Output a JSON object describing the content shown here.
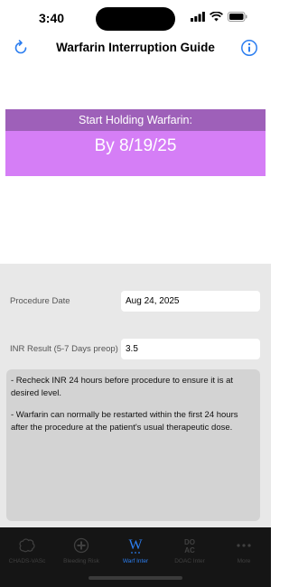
{
  "status_bar": {
    "time": "3:40"
  },
  "nav": {
    "title": "Warfarin Interruption Guide",
    "refresh_icon": "refresh-icon",
    "info_icon": "info-icon"
  },
  "hold": {
    "header": "Start Holding Warfarin:",
    "date_text": "By 8/19/25"
  },
  "form": {
    "procedure_date_label": "Procedure Date",
    "procedure_date_value": "Aug 24, 2025",
    "inr_label": "INR Result (5-7 Days preop)",
    "inr_value": "3.5"
  },
  "notes": [
    "- Recheck INR 24 hours before procedure to ensure it is at desired level.",
    "- Warfarin can normally be restarted within the first 24 hours after the procedure at the patient's usual therapeutic dose."
  ],
  "tabs": [
    {
      "label": "CHADS-VASc",
      "icon": "brain-icon",
      "active": false
    },
    {
      "label": "Bleeding Risk",
      "icon": "plus-circle-icon",
      "active": false
    },
    {
      "label": "Warf Inter",
      "icon": "warfarin-w-icon",
      "active": true
    },
    {
      "label": "DOAC Inter",
      "icon": "doac-icon",
      "active": false
    },
    {
      "label": "More",
      "icon": "more-dots-icon",
      "active": false
    }
  ],
  "colors": {
    "accent": "#2c7ef0",
    "hold_header_bg": "#9e60b9",
    "hold_date_bg": "#d57ef6",
    "form_bg": "#e8e8e8",
    "notes_bg": "#d3d3d3",
    "tab_bar_bg": "#151515"
  }
}
